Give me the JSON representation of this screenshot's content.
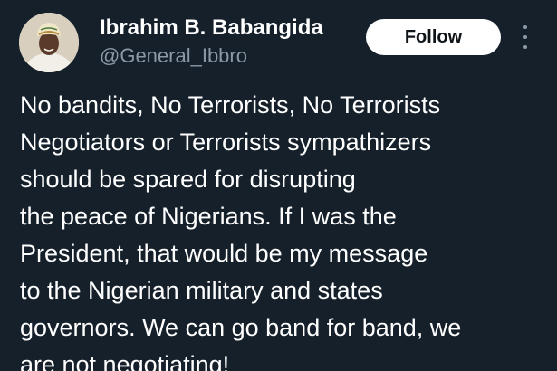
{
  "author": {
    "display_name": "Ibrahim B. Babangida",
    "handle": "@General_Ibbro"
  },
  "actions": {
    "follow_label": "Follow",
    "more_icon": "more-vertical-icon"
  },
  "tweet": {
    "lines": [
      "No bandits, No Terrorists, No Terrorists",
      "Negotiators or Terrorists sympathizers",
      "should be spared for disrupting",
      "the peace of Nigerians. If I was the",
      "President, that would be my message",
      "to the Nigerian military and states",
      "governors. We can go band for band, we",
      "are not negotiating!"
    ]
  },
  "colors": {
    "background": "#15202b",
    "text": "#ffffff",
    "secondary_text": "#8b98a5",
    "button_bg": "#ffffff",
    "button_text": "#0f1419"
  }
}
